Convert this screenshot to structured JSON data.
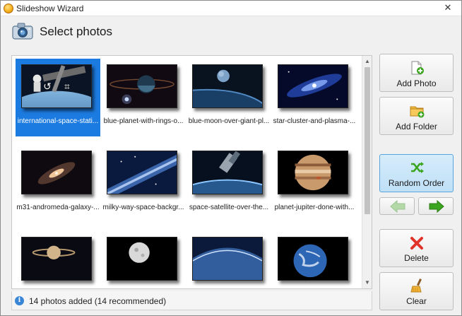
{
  "window": {
    "title": "Slideshow Wizard",
    "close_glyph": "✕"
  },
  "header": {
    "title": "Select photos",
    "icon": "camera-icon"
  },
  "photos": [
    {
      "caption": "international-space-stati...",
      "selected": true
    },
    {
      "caption": "blue-planet-with-rings-o...",
      "selected": false
    },
    {
      "caption": "blue-moon-over-giant-pl...",
      "selected": false
    },
    {
      "caption": "star-cluster-and-plasma-...",
      "selected": false
    },
    {
      "caption": "m31-andromeda-galaxy-...",
      "selected": false
    },
    {
      "caption": "milky-way-space-backgr...",
      "selected": false
    },
    {
      "caption": "space-satellite-over-the...",
      "selected": false
    },
    {
      "caption": "planet-jupiter-done-with...",
      "selected": false
    },
    {
      "caption": "",
      "selected": false
    },
    {
      "caption": "",
      "selected": false
    },
    {
      "caption": "",
      "selected": false
    },
    {
      "caption": "",
      "selected": false
    }
  ],
  "thumb_overlay": {
    "rotate_glyph": "↺",
    "crop_glyph": "⌗"
  },
  "scrollbar": {
    "up_glyph": "▲",
    "down_glyph": "▼"
  },
  "status": {
    "text": "14 photos added (14 recommended)",
    "info_glyph": "i"
  },
  "sidebar": {
    "add_photo": "Add Photo",
    "add_folder": "Add Folder",
    "random_order": "Random Order",
    "delete": "Delete",
    "clear": "Clear"
  },
  "colors": {
    "accent": "#1c7be0",
    "active_button": "#bfe0f7",
    "arrow_green": "#3ca51f"
  }
}
